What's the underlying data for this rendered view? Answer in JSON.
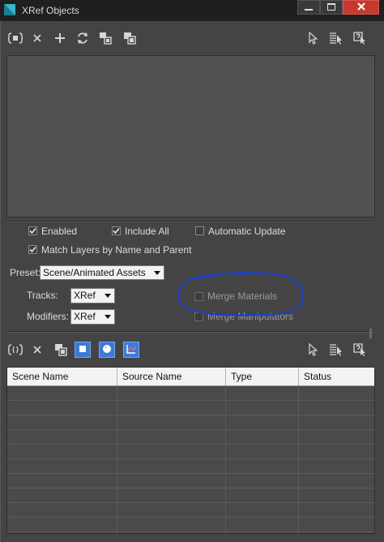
{
  "window": {
    "title": "XRef Objects",
    "accent": "#3d7ad6",
    "close_color": "#c6392f"
  },
  "top_toolbar": {
    "icons": [
      "add-xref-object-icon",
      "remove-icon",
      "add-icon",
      "refresh-icon",
      "convert-selected-icon",
      "merge-in-scene-icon",
      "select-icon",
      "select-by-name-icon",
      "highlight-selected-icon"
    ]
  },
  "options": {
    "enabled_label": "Enabled",
    "enabled_checked": true,
    "include_all_label": "Include All",
    "include_all_checked": true,
    "automatic_update_label": "Automatic Update",
    "automatic_update_checked": false,
    "match_layers_label": "Match Layers by Name and Parent",
    "match_layers_checked": true,
    "preset_label": "Preset:",
    "preset_value": "Scene/Animated Assets",
    "tracks_label": "Tracks:",
    "tracks_value": "XRef",
    "modifiers_label": "Modifiers:",
    "modifiers_value": "XRef",
    "merge_materials_label": "Merge Materials",
    "merge_materials_checked": false,
    "merge_manipulators_label": "Merge Manipulators",
    "merge_manipulators_checked": false
  },
  "annotation": {
    "circle_color": "#1e3fbf"
  },
  "bottom_toolbar": {
    "icons": [
      "add-xref-entity-icon",
      "remove-icon",
      "merge-icon",
      "view-objects-icon",
      "view-materials-icon",
      "view-controllers-icon",
      "select-icon",
      "select-by-name-icon",
      "highlight-selected-icon"
    ]
  },
  "table": {
    "columns": [
      "Scene Name",
      "Source Name",
      "Type",
      "Status"
    ],
    "rows": []
  }
}
